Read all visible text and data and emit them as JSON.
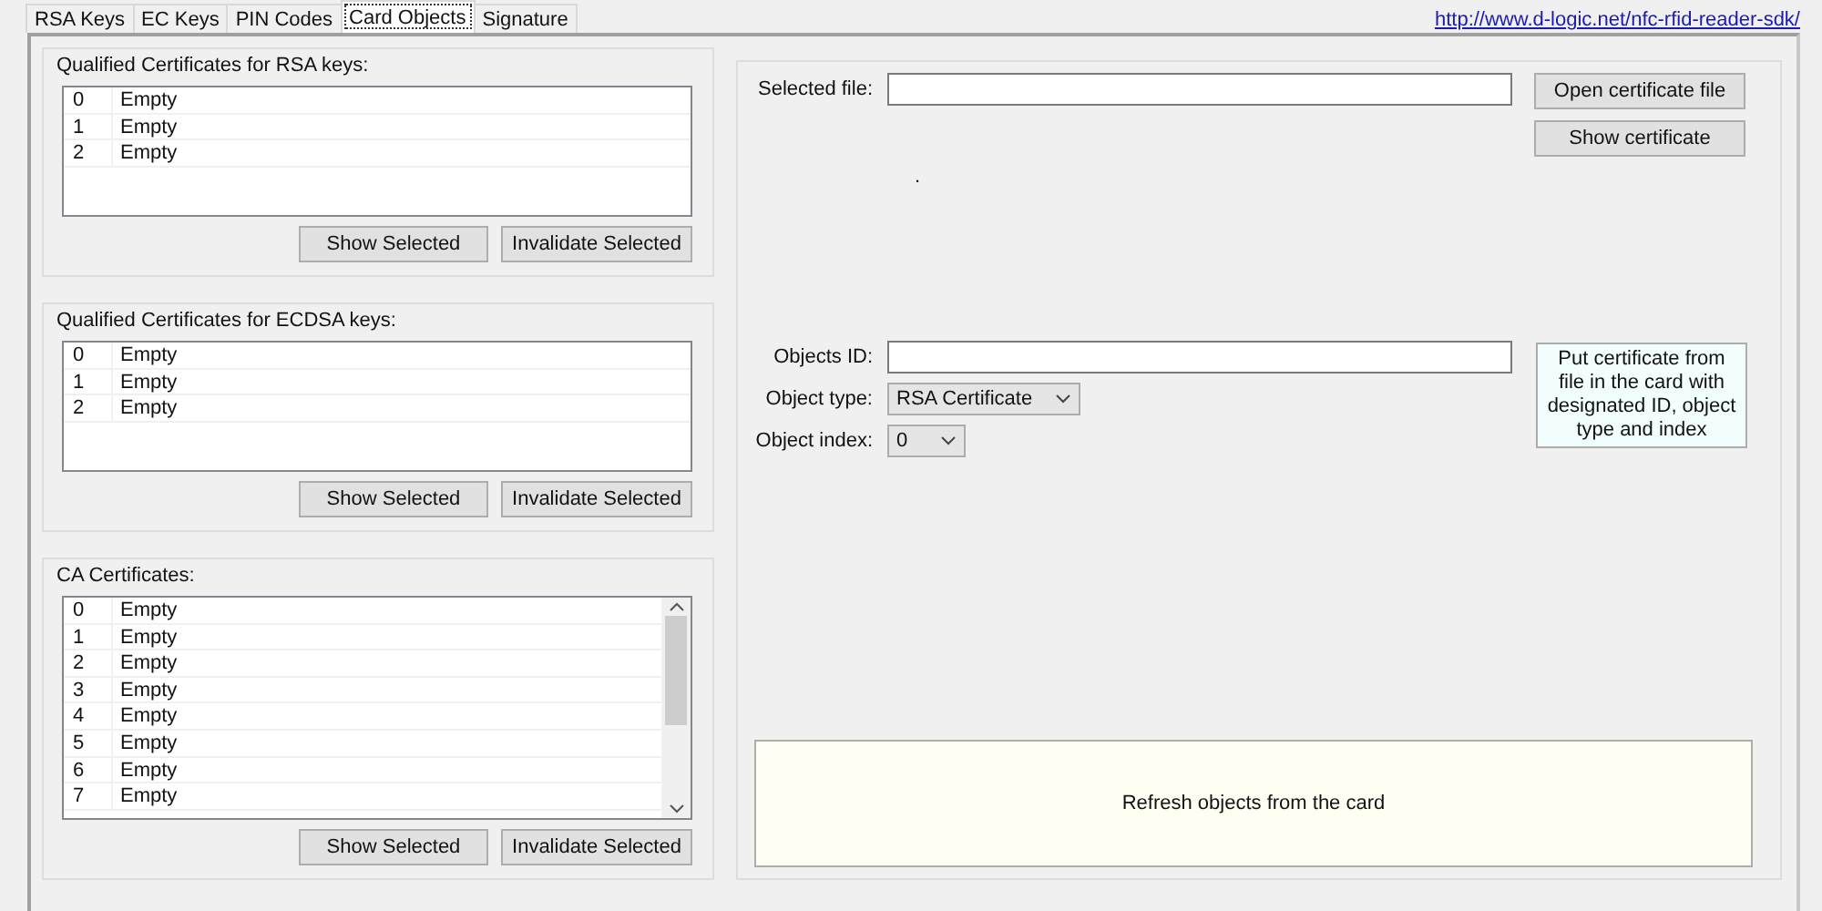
{
  "tabs": [
    {
      "label": "RSA Keys",
      "selected": false
    },
    {
      "label": "EC Keys",
      "selected": false
    },
    {
      "label": "PIN Codes",
      "selected": false
    },
    {
      "label": "Card Objects",
      "selected": true
    },
    {
      "label": "Signature",
      "selected": false
    }
  ],
  "link": "http://www.d-logic.net/nfc-rfid-reader-sdk/",
  "groups": [
    {
      "title": "Qualified Certificates for RSA keys:",
      "scrollable": false,
      "rows": [
        {
          "index": "0",
          "status": "Empty"
        },
        {
          "index": "1",
          "status": "Empty"
        },
        {
          "index": "2",
          "status": "Empty"
        }
      ],
      "buttons": [
        "Show Selected",
        "Invalidate Selected"
      ]
    },
    {
      "title": "Qualified Certificates for ECDSA keys:",
      "scrollable": false,
      "rows": [
        {
          "index": "0",
          "status": "Empty"
        },
        {
          "index": "1",
          "status": "Empty"
        },
        {
          "index": "2",
          "status": "Empty"
        }
      ],
      "buttons": [
        "Show Selected",
        "Invalidate Selected"
      ]
    },
    {
      "title": "CA Certificates:",
      "scrollable": true,
      "rows": [
        {
          "index": "0",
          "status": "Empty"
        },
        {
          "index": "1",
          "status": "Empty"
        },
        {
          "index": "2",
          "status": "Empty"
        },
        {
          "index": "3",
          "status": "Empty"
        },
        {
          "index": "4",
          "status": "Empty"
        },
        {
          "index": "5",
          "status": "Empty"
        },
        {
          "index": "6",
          "status": "Empty"
        },
        {
          "index": "7",
          "status": "Empty"
        }
      ],
      "buttons": [
        "Show Selected",
        "Invalidate Selected"
      ]
    }
  ],
  "file": {
    "label": "Selected file:",
    "open_button": "Open certificate file",
    "show_button": "Show certificate",
    "status": "."
  },
  "object": {
    "id_label": "Objects ID:",
    "type_label": "Object type:",
    "type_value": "RSA Certificate",
    "index_label": "Object index:",
    "index_value": "0",
    "put_button": "Put certificate from file in the card with designated ID, object type and index"
  },
  "refresh_button": "Refresh objects from the card"
}
